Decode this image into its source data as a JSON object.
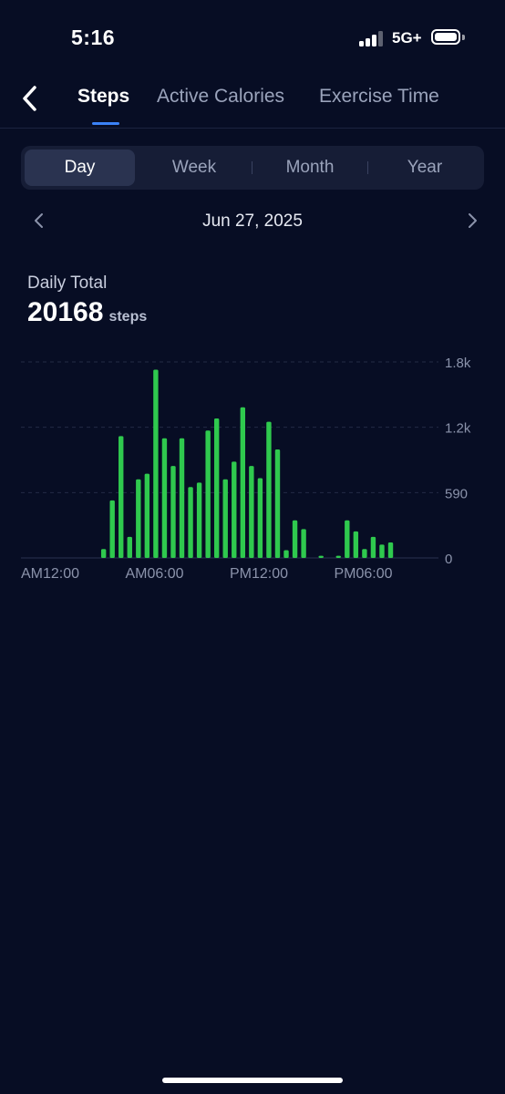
{
  "status": {
    "time": "5:16",
    "network": "5G+"
  },
  "tabs": [
    {
      "label": "Steps",
      "active": true
    },
    {
      "label": "Active Calories",
      "active": false
    },
    {
      "label": "Exercise Time",
      "active": false
    }
  ],
  "range": [
    {
      "label": "Day",
      "active": true
    },
    {
      "label": "Week",
      "active": false
    },
    {
      "label": "Month",
      "active": false
    },
    {
      "label": "Year",
      "active": false
    }
  ],
  "date": "Jun 27, 2025",
  "summary": {
    "label": "Daily Total",
    "value": "20168",
    "unit": "steps"
  },
  "colors": {
    "background": "#070d24",
    "bar": "#2fc94e",
    "accent": "#3b82f6"
  },
  "chart_data": {
    "type": "bar",
    "y_ticks": [
      "1.8k",
      "1.2k",
      "590",
      "0"
    ],
    "x_ticks": [
      "AM12:00",
      "AM06:00",
      "PM12:00",
      "PM06:00"
    ],
    "ylim": [
      0,
      1770
    ],
    "grid": true,
    "interval_minutes": 30,
    "values": [
      0,
      0,
      0,
      0,
      0,
      0,
      0,
      0,
      0,
      80,
      520,
      1100,
      190,
      710,
      760,
      1700,
      1080,
      830,
      1080,
      640,
      680,
      1150,
      1260,
      710,
      870,
      1360,
      830,
      720,
      1230,
      980,
      70,
      340,
      260,
      0,
      20,
      0,
      20,
      340,
      240,
      80,
      190,
      120,
      140,
      0,
      0,
      0,
      0,
      0
    ]
  }
}
